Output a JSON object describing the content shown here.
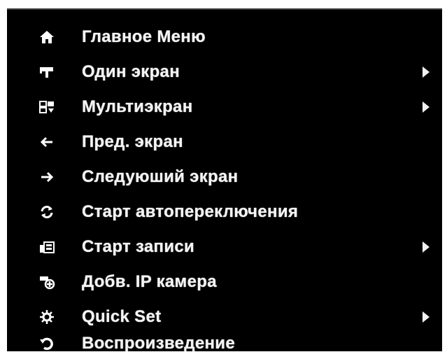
{
  "menu": {
    "items": [
      {
        "label": "Главное Меню",
        "icon": "home-icon",
        "submenu": false
      },
      {
        "label": "Один экран",
        "icon": "single-camera-icon",
        "submenu": true
      },
      {
        "label": "Мультиэкран",
        "icon": "multiscreen-icon",
        "submenu": true
      },
      {
        "label": "Пред. экран",
        "icon": "arrow-left-icon",
        "submenu": false
      },
      {
        "label": "Следуюший экран",
        "icon": "arrow-right-icon",
        "submenu": false
      },
      {
        "label": "Старт автопереключения",
        "icon": "auto-switch-icon",
        "submenu": false
      },
      {
        "label": "Старт записи",
        "icon": "record-icon",
        "submenu": true
      },
      {
        "label": "Добв. IP камера",
        "icon": "add-ip-camera-icon",
        "submenu": false
      },
      {
        "label": "Quick Set",
        "icon": "gear-icon",
        "submenu": true
      },
      {
        "label": "Воспроизведение",
        "icon": "playback-icon",
        "submenu": false
      }
    ]
  }
}
